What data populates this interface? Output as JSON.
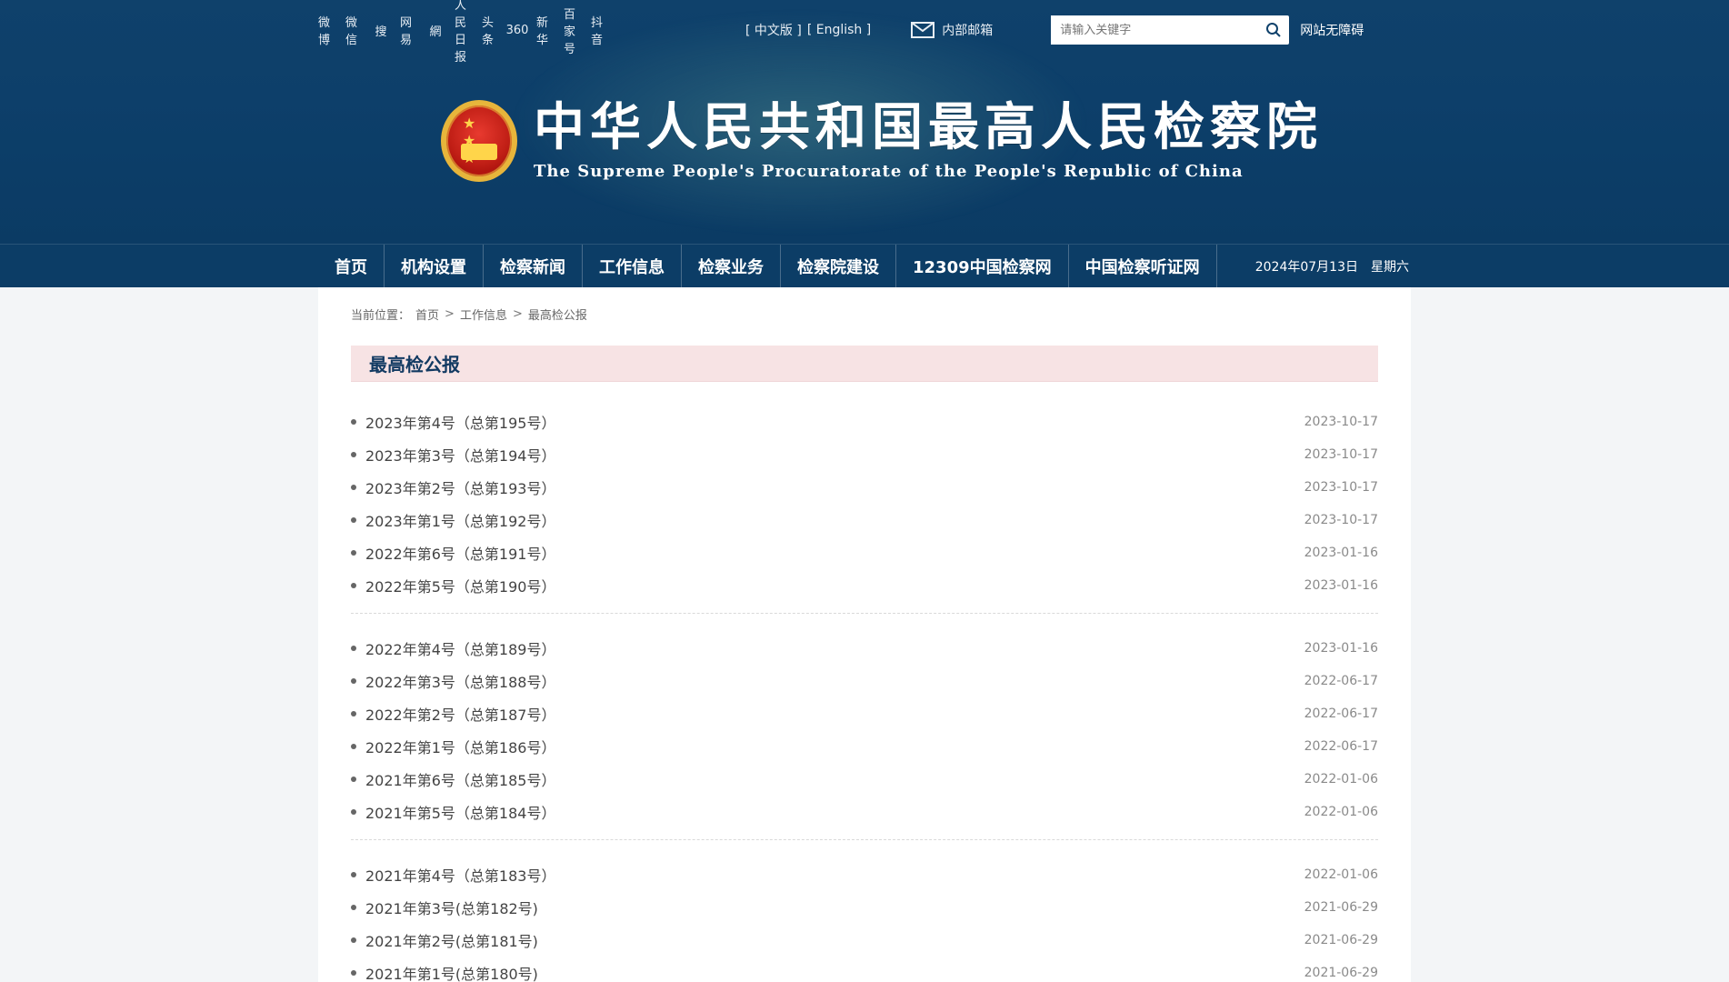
{
  "header": {
    "top": {
      "social_icons": [
        "weibo-icon",
        "wechat-icon",
        "sohu-icon",
        "netease-icon",
        "wangyi-icon",
        "people-daily-icon",
        "toutiao-icon",
        "360-icon",
        "xinhua-icon",
        "baijiahao-icon",
        "douyin-icon"
      ],
      "social_labels": [
        "微博",
        "微信",
        "搜",
        "网易",
        "網",
        "人民日报",
        "头条",
        "360",
        "新华",
        "百家号",
        "抖音"
      ],
      "lang_cn": "[ 中文版 ]",
      "lang_en": "[ English ]",
      "mail_label": "内部邮箱",
      "search_placeholder": "请输入关键字",
      "accessibility": "网站无障碍"
    },
    "banner": {
      "cn_title": "中华人民共和国最高人民检察院",
      "en_title": "The Supreme People's Procuratorate of the People's Republic of China"
    }
  },
  "nav": {
    "items": [
      "首页",
      "机构设置",
      "检察新闻",
      "工作信息",
      "检察业务",
      "检察院建设",
      "12309中国检察网",
      "中国检察听证网"
    ],
    "date": "2024年07月13日",
    "weekday": "星期六"
  },
  "breadcrumb": {
    "label": "当前位置：",
    "home": "首页",
    "level2": "工作信息",
    "level3": "最高检公报",
    "sep": ">"
  },
  "section": {
    "title": "最高检公报"
  },
  "groups": [
    {
      "items": [
        {
          "title": "2023年第4号（总第195号）",
          "date": "2023-10-17"
        },
        {
          "title": "2023年第3号（总第194号）",
          "date": "2023-10-17"
        },
        {
          "title": "2023年第2号（总第193号）",
          "date": "2023-10-17"
        },
        {
          "title": "2023年第1号（总第192号）",
          "date": "2023-10-17"
        },
        {
          "title": "2022年第6号（总第191号）",
          "date": "2023-01-16"
        },
        {
          "title": "2022年第5号（总第190号）",
          "date": "2023-01-16"
        }
      ]
    },
    {
      "items": [
        {
          "title": "2022年第4号（总第189号）",
          "date": "2023-01-16"
        },
        {
          "title": "2022年第3号（总第188号）",
          "date": "2022-06-17"
        },
        {
          "title": "2022年第2号（总第187号）",
          "date": "2022-06-17"
        },
        {
          "title": "2022年第1号（总第186号）",
          "date": "2022-06-17"
        },
        {
          "title": "2021年第6号（总第185号）",
          "date": "2022-01-06"
        },
        {
          "title": "2021年第5号（总第184号）",
          "date": "2022-01-06"
        }
      ]
    },
    {
      "items": [
        {
          "title": "2021年第4号（总第183号）",
          "date": "2022-01-06"
        },
        {
          "title": "2021年第3号(总第182号)",
          "date": "2021-06-29"
        },
        {
          "title": "2021年第2号(总第181号)",
          "date": "2021-06-29"
        },
        {
          "title": "2021年第1号(总第180号)",
          "date": "2021-06-29"
        }
      ]
    }
  ],
  "colors": {
    "header_bg": "#0f416b",
    "nav_bg": "#0c3d66",
    "section_bg": "#f7e3e4",
    "title_blue": "#123a62"
  }
}
